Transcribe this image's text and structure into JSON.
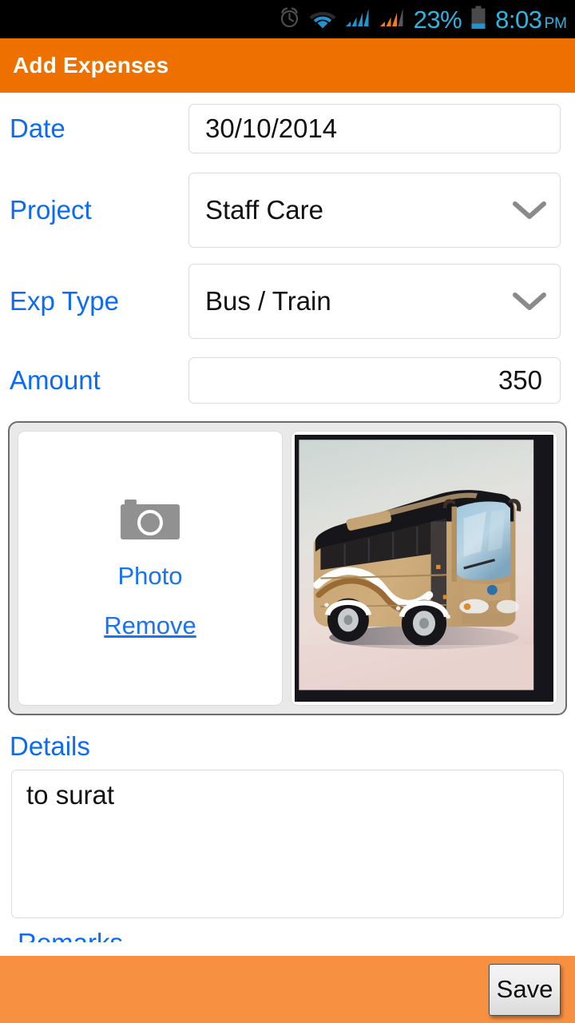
{
  "status_bar": {
    "alarm_icon": "alarm-clock-icon",
    "wifi_icon": "wifi-icon",
    "signal_1_icon": "cellular-signal-icon",
    "signal_2_icon": "cellular-signal-icon",
    "battery_percent": "23%",
    "battery_icon": "battery-icon",
    "time": "8:03",
    "am_pm": "PM",
    "accent_color": "#2fb4e0"
  },
  "header": {
    "title": "Add Expenses",
    "background_color": "#ee7100"
  },
  "form": {
    "label_color": "#0b6bf5",
    "rows": [
      {
        "label": "Date",
        "value": "30/10/2014",
        "type": "text",
        "align": "left"
      },
      {
        "label": "Project",
        "value": "Staff Care",
        "type": "select",
        "align": "left"
      },
      {
        "label": "Exp Type",
        "value": "Bus / Train",
        "type": "select",
        "align": "left"
      },
      {
        "label": "Amount",
        "value": "350",
        "type": "text",
        "align": "right"
      }
    ]
  },
  "photo_section": {
    "camera_icon": "camera-icon",
    "photo_label": "Photo",
    "remove_label": "Remove",
    "thumbnail_alt": "bus-photo",
    "panel_border_color": "#6d6d6d",
    "panel_fill_color": "#e9e9e9"
  },
  "details": {
    "label": "Details",
    "value": "to surat",
    "placeholder": ""
  },
  "clipped_row": {
    "label": "Remarks"
  },
  "bottom_bar": {
    "save_label": "Save",
    "background_color": "#f79041"
  }
}
